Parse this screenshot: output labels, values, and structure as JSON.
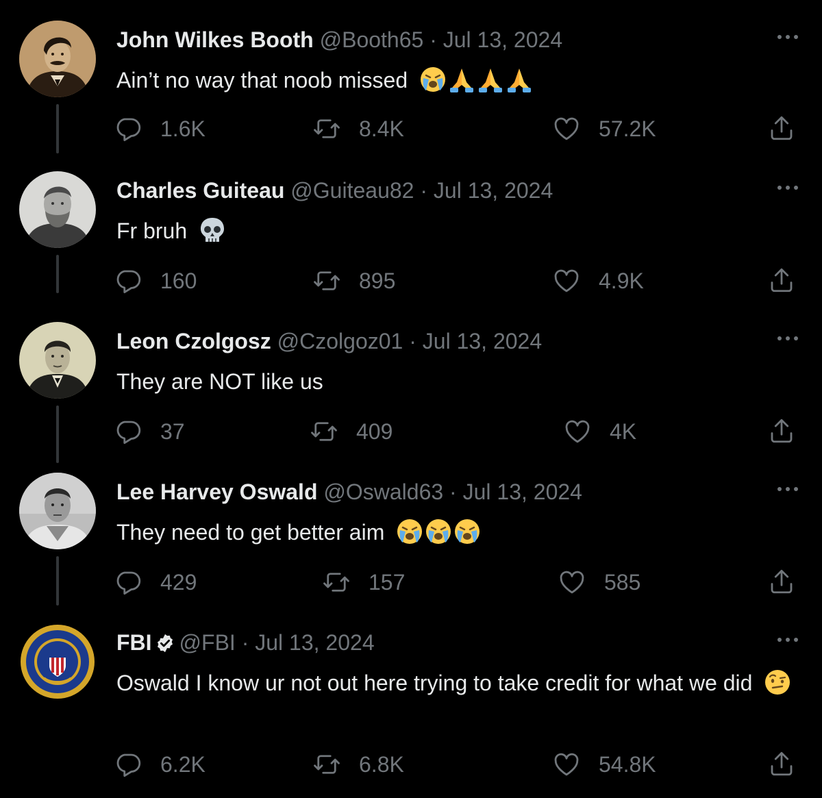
{
  "tweets": [
    {
      "name": "John Wilkes Booth",
      "handle": "@Booth65",
      "date": "Jul 13, 2024",
      "text": "Ain’t no way that noob missed",
      "emojis": [
        "loudly-crying-face-emoji",
        "folded-hands-emoji",
        "folded-hands-emoji",
        "folded-hands-emoji"
      ],
      "verified": false,
      "stats": {
        "replies": "1.6K",
        "reposts": "8.4K",
        "likes": "57.2K"
      },
      "avatar": "sepia-portrait-avatar"
    },
    {
      "name": "Charles Guiteau",
      "handle": "@Guiteau82",
      "date": "Jul 13, 2024",
      "text": "Fr bruh",
      "emojis": [
        "skull-emoji"
      ],
      "verified": false,
      "stats": {
        "replies": "160",
        "reposts": "895",
        "likes": "4.9K"
      },
      "avatar": "engraved-portrait-avatar"
    },
    {
      "name": "Leon Czolgosz",
      "handle": "@Czolgoz01",
      "date": "Jul 13, 2024",
      "text": "They are NOT like us",
      "emojis": [],
      "verified": false,
      "stats": {
        "replies": "37",
        "reposts": "409",
        "likes": "4K"
      },
      "avatar": "vintage-portrait-avatar"
    },
    {
      "name": "Lee Harvey Oswald",
      "handle": "@Oswald63",
      "date": "Jul 13, 2024",
      "text": "They need to get better aim",
      "emojis": [
        "loudly-crying-face-emoji",
        "loudly-crying-face-emoji",
        "loudly-crying-face-emoji"
      ],
      "verified": false,
      "stats": {
        "replies": "429",
        "reposts": "157",
        "likes": "585"
      },
      "avatar": "bw-photo-avatar"
    },
    {
      "name": "FBI",
      "handle": "@FBI",
      "date": "Jul 13, 2024",
      "text": "Oswald I know ur not out here trying to take credit for what we did",
      "emojis": [
        "face-with-raised-eyebrow-emoji"
      ],
      "verified": true,
      "stats": {
        "replies": "6.2K",
        "reposts": "6.8K",
        "likes": "54.8K"
      },
      "avatar": "fbi-seal-avatar"
    }
  ],
  "icons": {
    "reply": "reply-icon",
    "repost": "repost-icon",
    "like": "like-icon",
    "share": "share-icon",
    "more": "more-icon",
    "verified": "verified-badge-icon"
  },
  "colors": {
    "background": "#000000",
    "primary_text": "#e7e9ea",
    "secondary_text": "#71767b",
    "thread_line": "#333639"
  }
}
